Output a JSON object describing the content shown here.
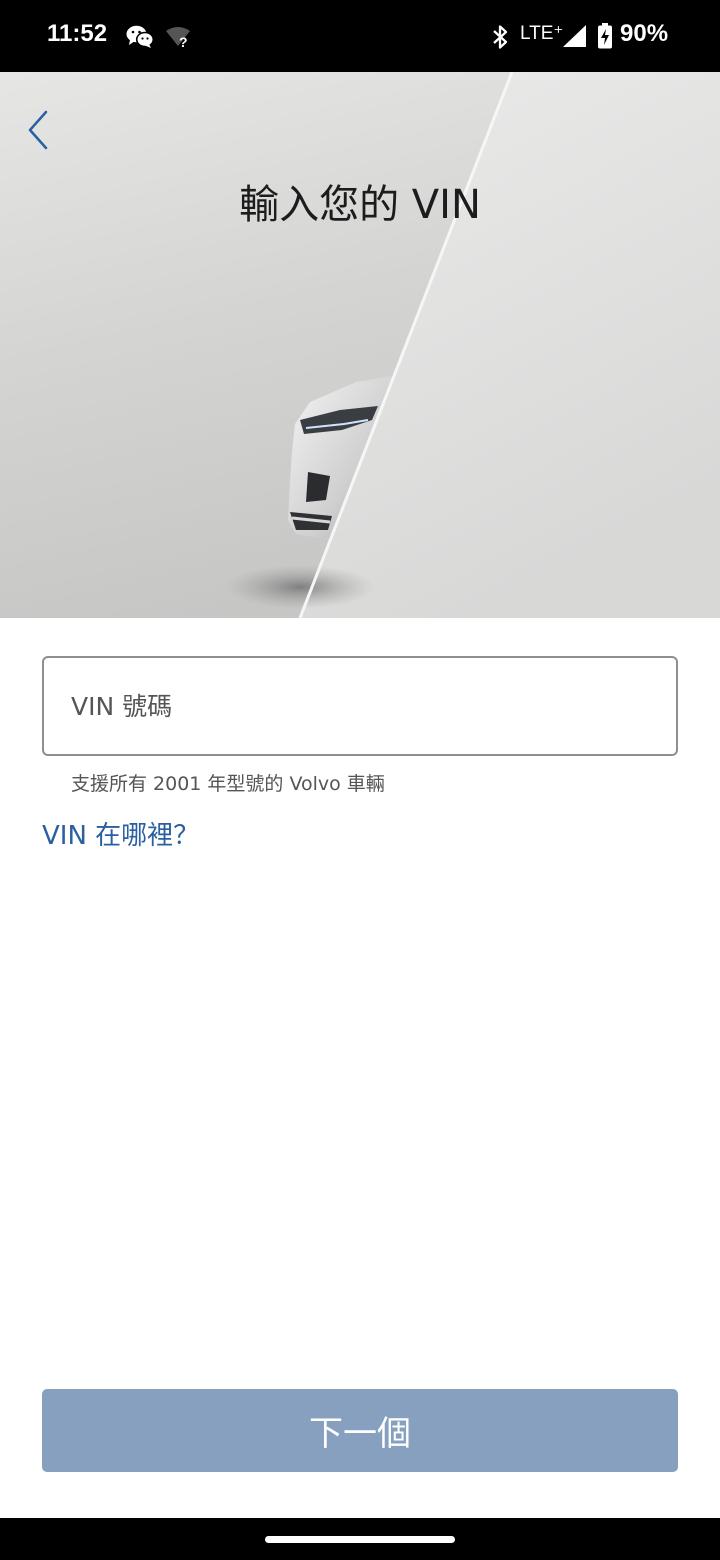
{
  "status_bar": {
    "time": "11:52",
    "network": "LTE⁺",
    "battery": "90%",
    "icons": [
      "wechat-icon",
      "wifi-unknown-icon",
      "bluetooth-icon",
      "signal-icon",
      "battery-charging-icon"
    ]
  },
  "header": {
    "title": "輸入您的 VIN",
    "back_icon": "chevron-left-icon"
  },
  "form": {
    "vin_placeholder": "VIN 號碼",
    "vin_value": "",
    "helper_text": "支援所有 2001 年型號的 Volvo 車輛",
    "where_link": "VIN 在哪裡？"
  },
  "footer": {
    "next_label": "下一個"
  },
  "colors": {
    "accent_link": "#2a5fa0",
    "button_disabled": "#87a0c0",
    "status_bar": "#000000"
  }
}
